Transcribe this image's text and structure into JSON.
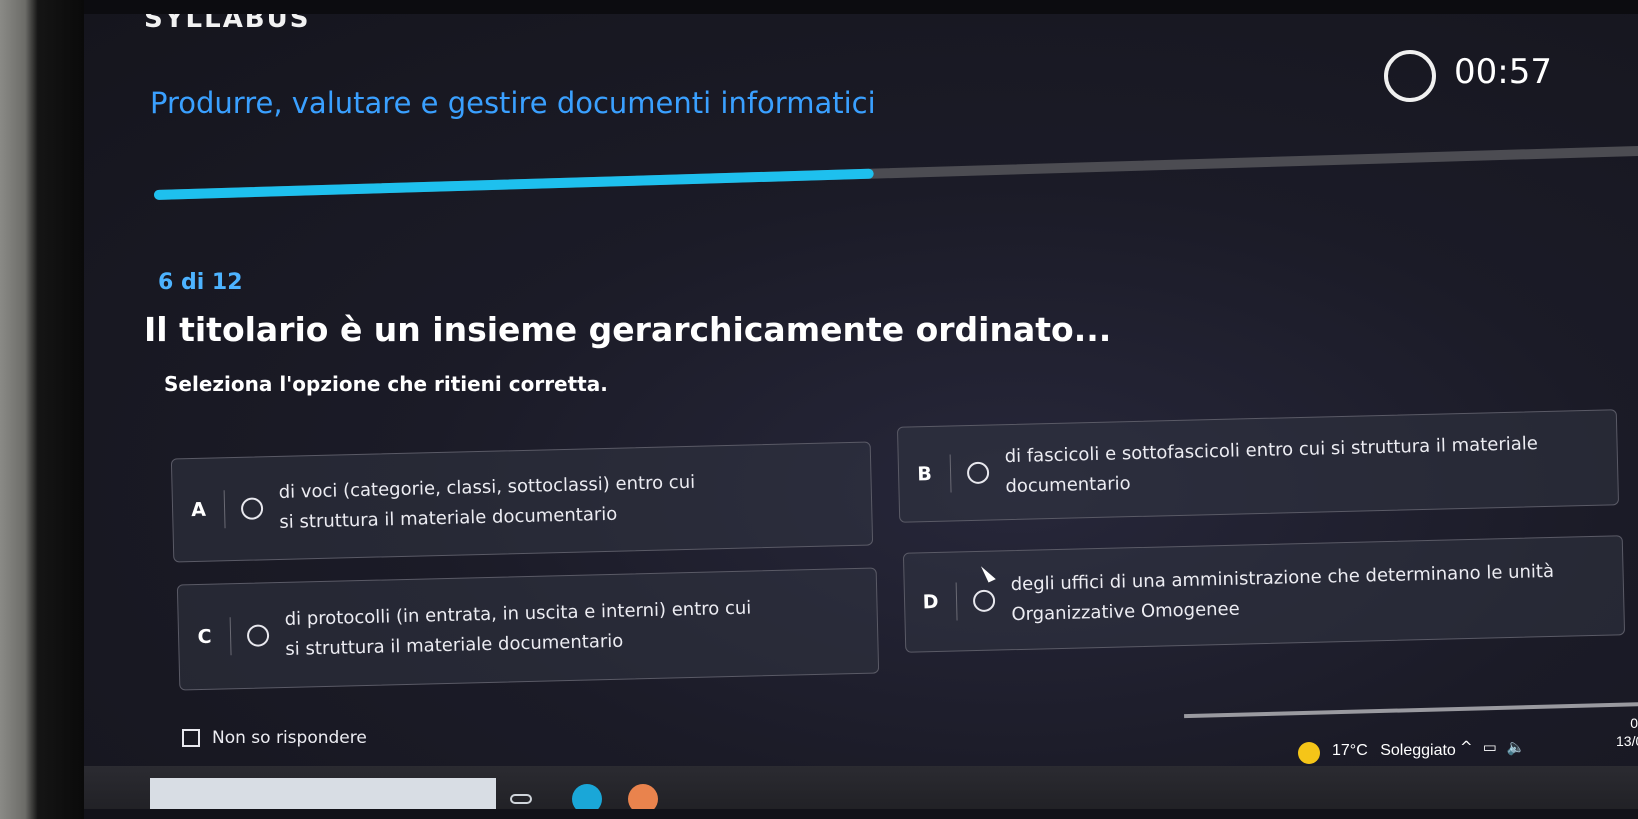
{
  "app": {
    "logo": "SYLLABUS"
  },
  "header": {
    "course_title": "Produrre, valutare e gestire documenti informatici",
    "timer": "00:57"
  },
  "progress": {
    "current": 6,
    "total": 12,
    "fraction": 0.48,
    "label": "6 di 12"
  },
  "question": {
    "text": "Il titolario è un insieme gerarchicamente ordinato...",
    "instruction": "Seleziona l'opzione che ritieni corretta."
  },
  "options": [
    {
      "letter": "A",
      "text": "di voci (categorie, classi, sottoclassi) entro cui si struttura il materiale documentario"
    },
    {
      "letter": "B",
      "text": "di fascicoli e sottofascicoli entro cui si struttura il materiale documentario"
    },
    {
      "letter": "C",
      "text": "di protocolli (in entrata, in uscita e interni) entro cui si struttura il materiale documentario"
    },
    {
      "letter": "D",
      "text": "degli uffici di una amministrazione che determinano le unità Organizzative Omogenee"
    }
  ],
  "no_answer": {
    "label": "Non so rispondere",
    "checked": false
  },
  "taskbar": {
    "weather_temp": "17°C",
    "weather_text": "Soleggiato",
    "clock_time": "0",
    "clock_date": "13/0"
  },
  "colors": {
    "accent": "#3aa0ff",
    "progress": "#1ec0ee",
    "weather": "#f5c518"
  }
}
